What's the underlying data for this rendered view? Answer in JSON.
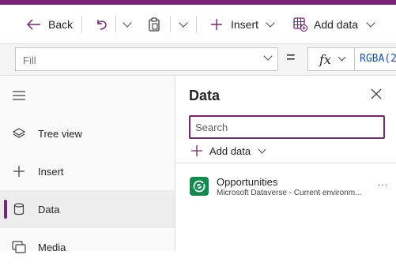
{
  "toolbar": {
    "back_label": "Back",
    "insert_label": "Insert",
    "add_data_label": "Add data"
  },
  "formula_bar": {
    "property": "Fill",
    "equals": "=",
    "fx_label": "fx",
    "formula_text": "RGBA(2"
  },
  "left_nav": {
    "items": [
      {
        "label": "Tree view",
        "icon": "layers-icon"
      },
      {
        "label": "Insert",
        "icon": "plus-icon"
      },
      {
        "label": "Data",
        "icon": "database-icon",
        "active": true
      },
      {
        "label": "Media",
        "icon": "media-icon"
      }
    ]
  },
  "data_panel": {
    "title": "Data",
    "search_placeholder": "Search",
    "add_data_label": "Add data",
    "sources": [
      {
        "name": "Opportunities",
        "subtitle": "Microsoft Dataverse - Current environm...",
        "more": "..."
      }
    ]
  },
  "colors": {
    "accent": "#742774",
    "dataverse": "#128a4d"
  }
}
